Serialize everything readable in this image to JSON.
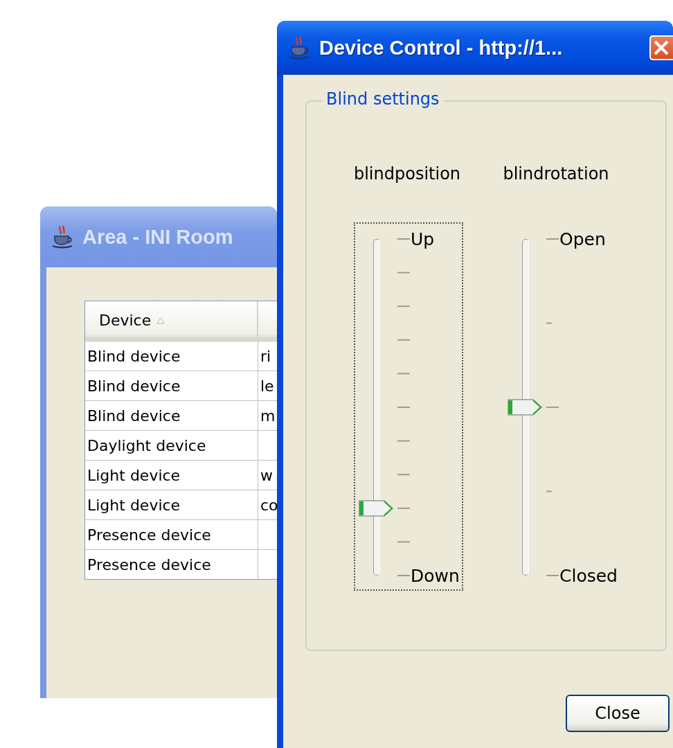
{
  "back_window": {
    "title": "Area - INI Room",
    "active": false,
    "table": {
      "columns": [
        {
          "label": "Device",
          "sorted": true
        }
      ],
      "rows": [
        {
          "device": "Blind device",
          "column_2": "ri"
        },
        {
          "device": "Blind device",
          "column_2": "le"
        },
        {
          "device": "Blind device",
          "column_2": "m"
        },
        {
          "device": "Daylight device"
        },
        {
          "device": "Light device",
          "column_2": "w"
        },
        {
          "device": "Light device",
          "column_2": "co"
        },
        {
          "device": "Presence device"
        },
        {
          "device": "Presence device"
        }
      ]
    }
  },
  "front_window": {
    "title": "Device Control - http://1...",
    "active": true,
    "group": {
      "title": "Blind settings",
      "sliders": [
        {
          "kind": "fine",
          "label": "blindposition",
          "max_label": "Up",
          "min_label": "Down",
          "level": 0.2,
          "focused": true
        },
        {
          "kind": "coarse",
          "label": "blindrotation",
          "max_label": "Open",
          "min_label": "Closed",
          "level": 0.5,
          "focused": false
        }
      ]
    },
    "buttons": [
      {
        "label": "Close"
      }
    ]
  }
}
